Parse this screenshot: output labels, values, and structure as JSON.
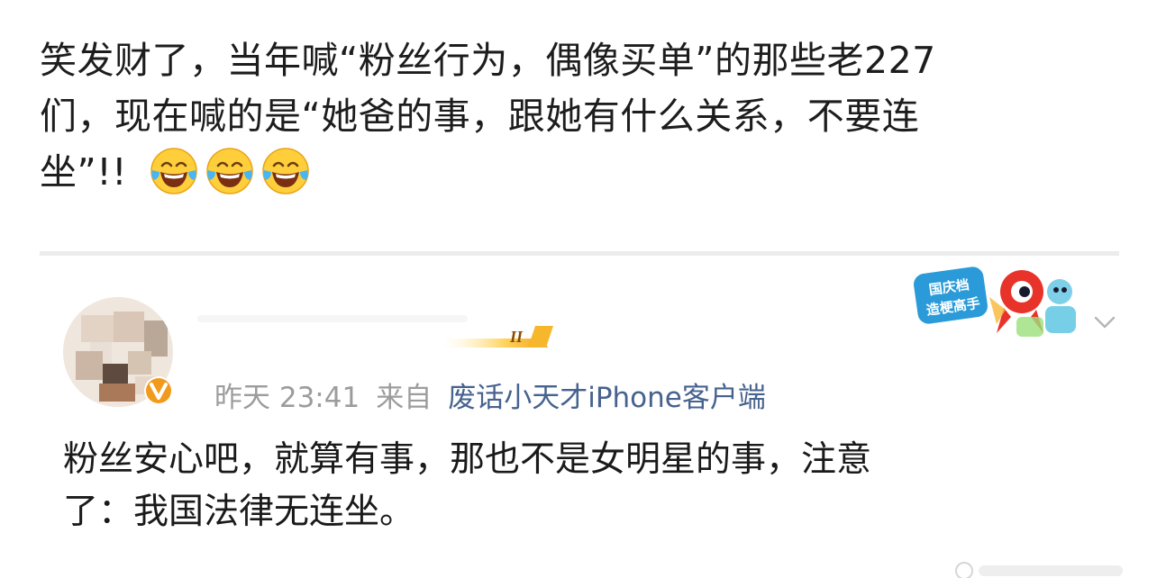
{
  "post": {
    "line1": "笑发财了，当年喊“粉丝行为，偶像买单”的那些老227",
    "line2": "们，现在喊的是“她爸的事，跟她有什么关系，不要连",
    "line3": "坐”!!",
    "emoji_count": 3,
    "emoji_name": "laugh-cry-emoji"
  },
  "embedded_comment": {
    "rank_badge_text": "II",
    "time": "昨天 23:41",
    "source_prefix": "来自",
    "source_client": "废话小天才iPhone客户端",
    "badge_line1": "国庆档",
    "badge_line2": "造梗高手",
    "comment_line1": "粉丝安心吧，就算有事，那也不是女明星的事，注意",
    "comment_line2": "了：我国法律无连坐。"
  },
  "colors": {
    "meta_gray": "#9c9c9c",
    "source_blue": "#46628f",
    "verified_orange": "#f29a1c",
    "divider": "#ececec"
  }
}
